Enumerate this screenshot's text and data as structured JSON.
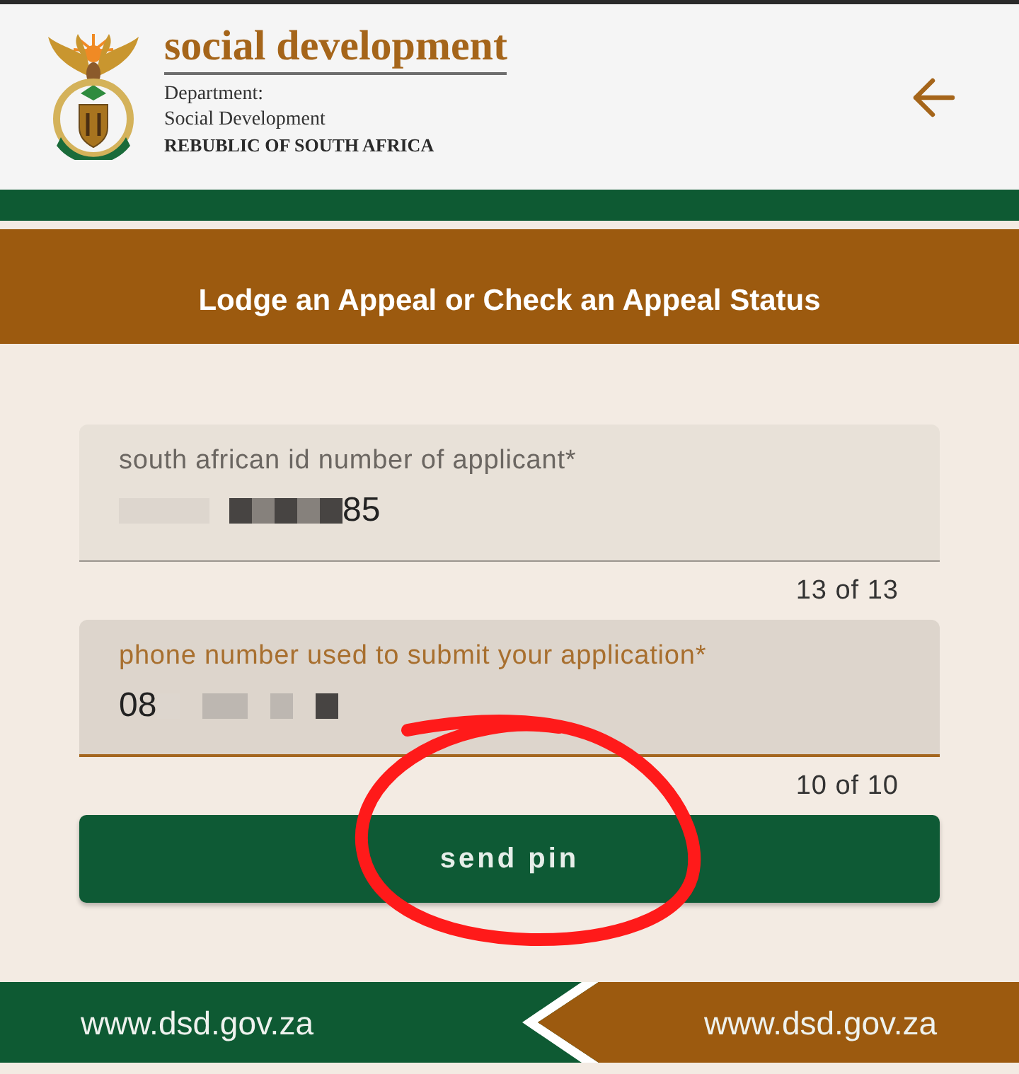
{
  "header": {
    "title": "social development",
    "lines": [
      "Department:",
      "Social Development"
    ],
    "country": "REBUBLIC OF SOUTH AFRICA"
  },
  "banner": {
    "title": "Lodge an Appeal or Check an Appeal Status"
  },
  "form": {
    "fields": [
      {
        "label": "south african id number of applicant*",
        "focused": false,
        "value_parts": [
          {
            "kind": "blur"
          },
          {
            "kind": "pixels"
          },
          {
            "kind": "text",
            "text": "85"
          }
        ],
        "counter": "13 of 13"
      },
      {
        "label": "phone number used to submit your application*",
        "focused": true,
        "value_parts": [
          {
            "kind": "text",
            "text": "08"
          },
          {
            "kind": "smudge"
          }
        ],
        "counter": "10 of 10"
      }
    ],
    "button": "send pin"
  },
  "footer": {
    "links": [
      "www.dsd.gov.za",
      "www.dsd.gov.za"
    ]
  }
}
